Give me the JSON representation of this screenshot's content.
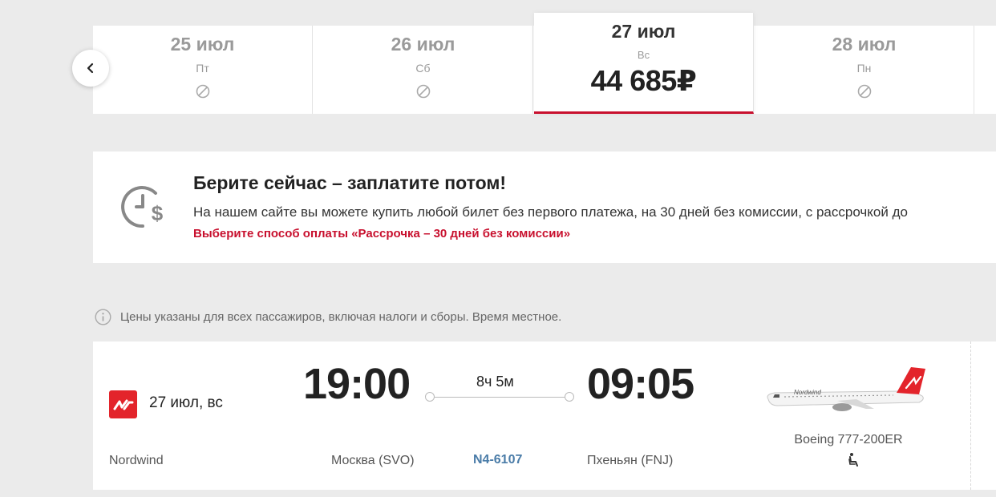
{
  "date_strip": {
    "days": [
      {
        "date": "25 июл",
        "weekday": "Пт",
        "available": false
      },
      {
        "date": "26 июл",
        "weekday": "Сб",
        "available": false
      },
      {
        "date": "27 июл",
        "weekday": "Вс",
        "price": "44 685₽",
        "available": true,
        "selected": true
      },
      {
        "date": "28 июл",
        "weekday": "Пн",
        "available": false
      }
    ],
    "prev_icon": "chevron-left-icon",
    "unavailable_icon": "not-available-icon",
    "accent_color": "#c8102e"
  },
  "promo": {
    "icon": "clock-dollar-icon",
    "title": "Берите сейчас – заплатите потом!",
    "text": "На нашем сайте вы можете купить любой билет без первого платежа, на 30 дней без комиссии, с рассрочкой до",
    "link": "Выберите способ оплаты «Рассрочка – 30 дней без комиссии»"
  },
  "notice": {
    "icon": "info-icon",
    "text": "Цены указаны для всех пассажиров, включая налоги и сборы. Время местное."
  },
  "flight": {
    "airline_logo": "nordwind-logo-icon",
    "date": "27 июл, вс",
    "airline": "Nordwind",
    "departure_time": "19:00",
    "arrival_time": "09:05",
    "duration": "8ч 5м",
    "departure_city": "Москва (SVO)",
    "arrival_city": "Пхеньян (FNJ)",
    "flight_number": "N4-6107",
    "aircraft": "Boeing 777-200ER",
    "seat_icon": "seat-icon",
    "brand_color": "#e3242b"
  }
}
